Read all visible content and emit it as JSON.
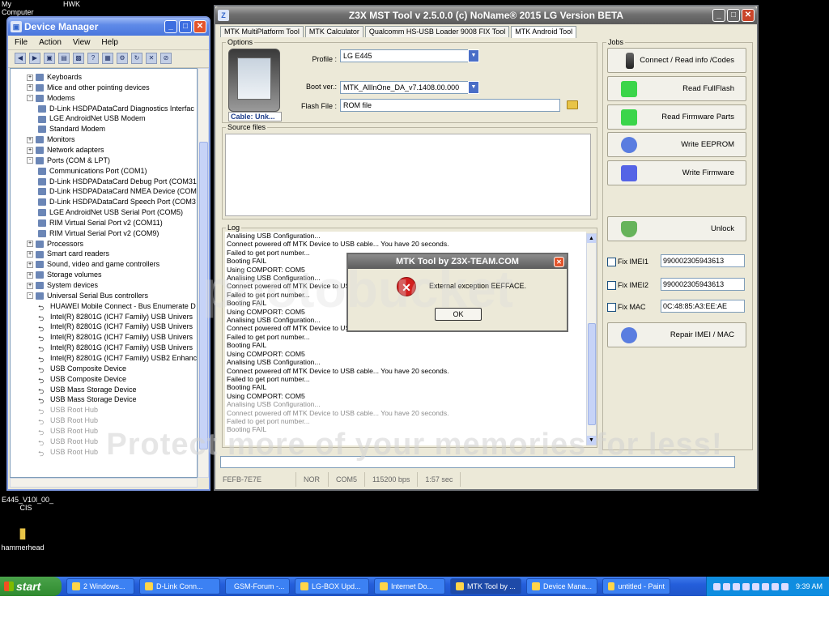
{
  "desktop": {
    "top_left_labels": [
      "My Computer",
      "HWK"
    ],
    "icons": [
      {
        "label": "E445_V10l_00_\nCIS"
      },
      {
        "label": "hammerhead"
      }
    ]
  },
  "device_manager": {
    "title": "Device Manager",
    "menu": [
      "File",
      "Action",
      "View",
      "Help"
    ],
    "tree": [
      {
        "label": "Keyboards",
        "level": 1,
        "expander": "+"
      },
      {
        "label": "Mice and other pointing devices",
        "level": 1,
        "expander": "+"
      },
      {
        "label": "Modems",
        "level": 1,
        "expander": "-"
      },
      {
        "label": "D-Link HSDPADataCard Diagnostics Interfac",
        "level": 2
      },
      {
        "label": "LGE AndroidNet USB Modem",
        "level": 2
      },
      {
        "label": "Standard Modem",
        "level": 2
      },
      {
        "label": "Monitors",
        "level": 1,
        "expander": "+"
      },
      {
        "label": "Network adapters",
        "level": 1,
        "expander": "+"
      },
      {
        "label": "Ports (COM & LPT)",
        "level": 1,
        "expander": "-"
      },
      {
        "label": "Communications Port (COM1)",
        "level": 2
      },
      {
        "label": "D-Link HSDPADataCard Debug Port (COM31",
        "level": 2
      },
      {
        "label": "D-Link HSDPADataCard NMEA Device (COM",
        "level": 2
      },
      {
        "label": "D-Link HSDPADataCard Speech Port (COM3",
        "level": 2
      },
      {
        "label": "LGE AndroidNet USB Serial Port (COM5)",
        "level": 2
      },
      {
        "label": "RIM Virtual Serial Port v2 (COM11)",
        "level": 2
      },
      {
        "label": "RIM Virtual Serial Port v2 (COM9)",
        "level": 2
      },
      {
        "label": "Processors",
        "level": 1,
        "expander": "+"
      },
      {
        "label": "Smart card readers",
        "level": 1,
        "expander": "+"
      },
      {
        "label": "Sound, video and game controllers",
        "level": 1,
        "expander": "+"
      },
      {
        "label": "Storage volumes",
        "level": 1,
        "expander": "+"
      },
      {
        "label": "System devices",
        "level": 1,
        "expander": "+"
      },
      {
        "label": "Universal Serial Bus controllers",
        "level": 1,
        "expander": "-"
      },
      {
        "label": "HUAWEI Mobile Connect - Bus Enumerate D",
        "level": 2,
        "usb": true
      },
      {
        "label": "Intel(R) 82801G (ICH7 Family) USB Univers",
        "level": 2,
        "usb": true
      },
      {
        "label": "Intel(R) 82801G (ICH7 Family) USB Univers",
        "level": 2,
        "usb": true
      },
      {
        "label": "Intel(R) 82801G (ICH7 Family) USB Univers",
        "level": 2,
        "usb": true
      },
      {
        "label": "Intel(R) 82801G (ICH7 Family) USB Univers",
        "level": 2,
        "usb": true
      },
      {
        "label": "Intel(R) 82801G (ICH7 Family) USB2 Enhanc",
        "level": 2,
        "usb": true
      },
      {
        "label": "USB Composite Device",
        "level": 2,
        "usb": true
      },
      {
        "label": "USB Composite Device",
        "level": 2,
        "usb": true
      },
      {
        "label": "USB Mass Storage Device",
        "level": 2,
        "usb": true
      },
      {
        "label": "USB Mass Storage Device",
        "level": 2,
        "usb": true
      },
      {
        "label": "USB Root Hub",
        "level": 2,
        "usb": true,
        "dim": true
      },
      {
        "label": "USB Root Hub",
        "level": 2,
        "usb": true,
        "dim": true
      },
      {
        "label": "USB Root Hub",
        "level": 2,
        "usb": true,
        "dim": true
      },
      {
        "label": "USB Root Hub",
        "level": 2,
        "usb": true,
        "dim": true
      },
      {
        "label": "USB Root Hub",
        "level": 2,
        "usb": true,
        "dim": true
      }
    ]
  },
  "z3x": {
    "title": "Z3X MST Tool v 2.5.0.0 (c) NoName® 2015 LG Version BETA",
    "tabs": [
      "MTK MultiPlatform Tool",
      "MTK Calculator",
      "Qualcomm HS-USB Loader 9008 FIX Tool",
      "MTK Android Tool"
    ],
    "active_tab": "MTK Android Tool",
    "options_label": "Options",
    "cable_text": "Cable: Unk...",
    "profile_label": "Profile :",
    "profile_value": "LG E445",
    "bootver_label": "Boot ver.:",
    "bootver_value": "MTK_AllInOne_DA_v7.1408.00.000",
    "flashfile_label": "Flash File :",
    "flashfile_value": "ROM file",
    "source_files_label": "Source files",
    "log_label": "Log",
    "jobs_label": "Jobs",
    "jobs": [
      {
        "label": "Connect / Read info /Codes",
        "icon": "phone-icon"
      },
      {
        "label": "Read FullFlash",
        "icon": "green-chip-icon"
      },
      {
        "label": "Read Firmware Parts",
        "icon": "green-chip-icon"
      },
      {
        "label": "Write EEPROM",
        "icon": "blue-gear-icon"
      },
      {
        "label": "Write Firmware",
        "icon": "blue-chip-icon"
      },
      {
        "label": "Unlock",
        "icon": "shield-icon"
      },
      {
        "label": "Repair IMEI / MAC",
        "icon": "blue-gear-icon"
      }
    ],
    "fix_imei1_label": "Fix IMEI1",
    "fix_imei1_value": "990002305943613",
    "fix_imei2_label": "Fix IMEI2",
    "fix_imei2_value": "990002305943613",
    "fix_mac_label": "Fix MAC",
    "fix_mac_value": "0C:48:85:A3:EE:AE",
    "log_lines": [
      {
        "text": "Analising USB Configuration...",
        "dim": false
      },
      {
        "text": "Connect powered off MTK Device to USB cable... You have 20 seconds.",
        "dim": false
      },
      {
        "text": "Failed to get port number...",
        "dim": false
      },
      {
        "text": "Booting FAIL",
        "dim": false
      },
      {
        "text": "Using COMPORT: COM5",
        "dim": false
      },
      {
        "text": "Analising USB Configuration...",
        "dim": false
      },
      {
        "text": "Connect powered off MTK Device to USB cable... You have 20 seconds.",
        "dim": false
      },
      {
        "text": "Failed to get port number...",
        "dim": false
      },
      {
        "text": "Booting FAIL",
        "dim": false
      },
      {
        "text": "Using COMPORT: COM5",
        "dim": false
      },
      {
        "text": "Analising USB Configuration...",
        "dim": false
      },
      {
        "text": "Connect powered off MTK Device to USB cable... You have 20 seconds.",
        "dim": false
      },
      {
        "text": "Failed to get port number...",
        "dim": false
      },
      {
        "text": "Booting FAIL",
        "dim": false
      },
      {
        "text": "Using COMPORT: COM5",
        "dim": false
      },
      {
        "text": "Analising USB Configuration...",
        "dim": false
      },
      {
        "text": "Connect powered off MTK Device to USB cable... You have 20 seconds.",
        "dim": false
      },
      {
        "text": "Failed to get port number...",
        "dim": false
      },
      {
        "text": "Booting FAIL",
        "dim": false
      },
      {
        "text": "Using COMPORT: COM5",
        "dim": false
      },
      {
        "text": "Analising USB Configuration...",
        "dim": true
      },
      {
        "text": "Connect powered off MTK Device to USB cable... You have 20 seconds.",
        "dim": true
      },
      {
        "text": "Failed to get port number...",
        "dim": true
      },
      {
        "text": "Booting FAIL",
        "dim": true
      }
    ],
    "status": [
      "FEFB-7E7E",
      "NOR",
      "COM5",
      "115200 bps",
      "1:57 sec"
    ]
  },
  "dialog": {
    "title": "MTK Tool by Z3X-TEAM.COM",
    "message": "External exception EEFFACE.",
    "ok_label": "OK"
  },
  "watermark": {
    "text": "Protect more of your memories for less!",
    "brand": "photobucket"
  },
  "taskbar": {
    "start_label": "start",
    "tasks": [
      {
        "label": "2 Windows..."
      },
      {
        "label": "D-Link Conn..."
      },
      {
        "label": "GSM-Forum -..."
      },
      {
        "label": "LG-BOX Upd..."
      },
      {
        "label": "Internet Do..."
      },
      {
        "label": "MTK Tool by ...",
        "active": true
      },
      {
        "label": "Device Mana..."
      },
      {
        "label": "untitled - Paint"
      }
    ],
    "clock": "9:39 AM"
  },
  "colors": {
    "xp_blue": "#245edb",
    "xp_green": "#2f8b2f",
    "error_red": "#d21f1f",
    "window_bg": "#ece9d8"
  }
}
